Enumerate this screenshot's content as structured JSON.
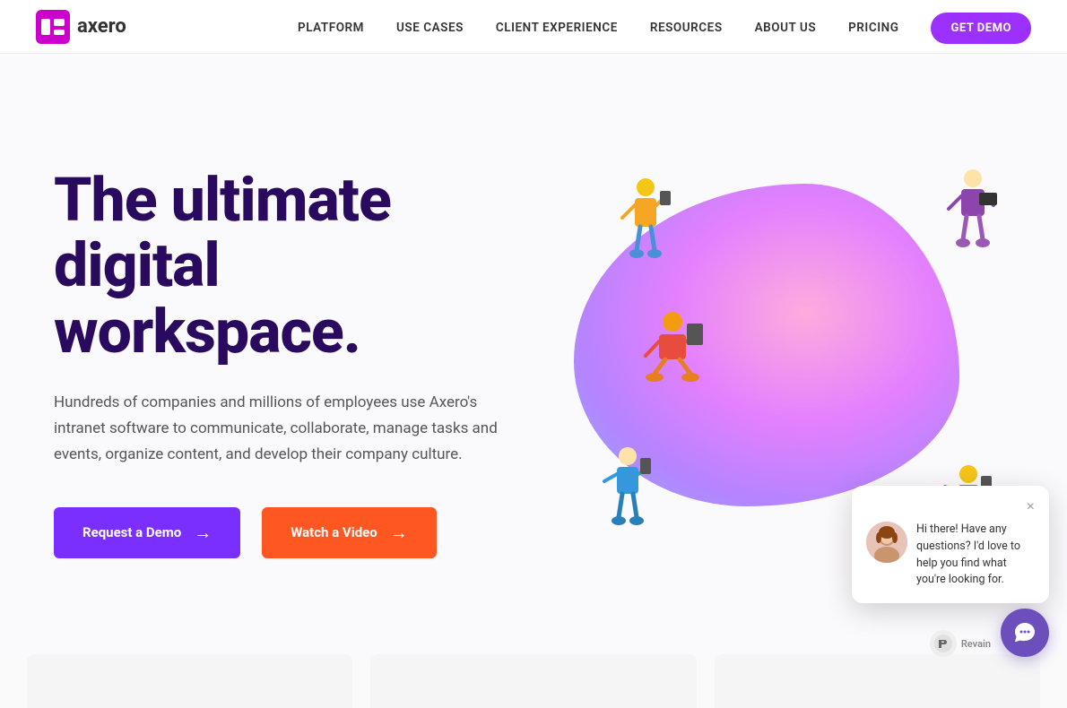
{
  "nav": {
    "logo_text": "axero",
    "links": [
      {
        "id": "platform",
        "label": "PLATFORM"
      },
      {
        "id": "use-cases",
        "label": "USE CASES"
      },
      {
        "id": "client-experience",
        "label": "CLIENT EXPERIENCE"
      },
      {
        "id": "resources",
        "label": "RESOURCES"
      },
      {
        "id": "about-us",
        "label": "ABOUT US"
      },
      {
        "id": "pricing",
        "label": "PRICING"
      }
    ],
    "cta_label": "GET DEMO"
  },
  "hero": {
    "title_line1": "The ultimate digital",
    "title_line2": "workspace.",
    "subtitle": "Hundreds of companies and millions of employees use Axero's intranet software to communicate, collaborate, manage tasks and events, organize content, and develop their company culture.",
    "btn_demo": "Request a Demo",
    "btn_video": "Watch a Video",
    "arrow": "→"
  },
  "chat": {
    "message": "Hi there! Have any questions? I'd love to help you find what you're looking for.",
    "close_icon": "×"
  },
  "revain": {
    "label": "Revain"
  }
}
